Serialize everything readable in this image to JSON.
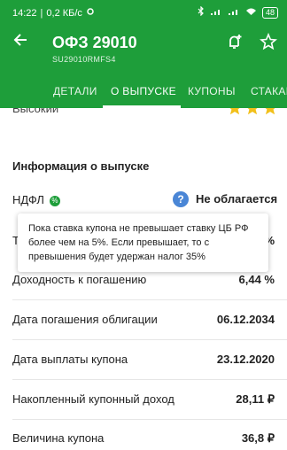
{
  "status_bar": {
    "time": "14:22",
    "speed": "0,2 КБ/с",
    "battery": "48"
  },
  "app_bar": {
    "title": "ОФЗ 29010",
    "subtitle": "SU29010RMFS4"
  },
  "tabs": [
    "ДЕТАЛИ",
    "О ВЫПУСКЕ",
    "КУПОНЫ",
    "СТАКАН"
  ],
  "rating": {
    "label": "Высокий"
  },
  "section": {
    "title": "Информация о выпуске"
  },
  "ndfl": {
    "label": "НДФЛ",
    "value": "Не облагается"
  },
  "tooltip": {
    "text": "Пока ставка купона не превышает ставку ЦБ РФ более чем на 5%. Если превышает, то с превышения будет удержан налог 35%"
  },
  "rows": [
    {
      "label": "Доходность к погашению",
      "value": "6,44 %"
    },
    {
      "label": "Дата погашения облигации",
      "value": "06.12.2034"
    },
    {
      "label": "Дата выплаты купона",
      "value": "23.12.2020"
    },
    {
      "label": "Накопленный купонный доход",
      "value": "28,11 ₽"
    },
    {
      "label": "Величина купона",
      "value": "36,8 ₽"
    }
  ],
  "obscured_row": {
    "label_start": "Т",
    "value_end": "%"
  },
  "colors": {
    "brand": "#1e9e3a",
    "star": "#f2c01a",
    "help": "#4a86d6"
  },
  "icons": {
    "back": "arrow-left-icon",
    "alert": "bell-plus-icon",
    "favorite": "star-outline-icon"
  }
}
